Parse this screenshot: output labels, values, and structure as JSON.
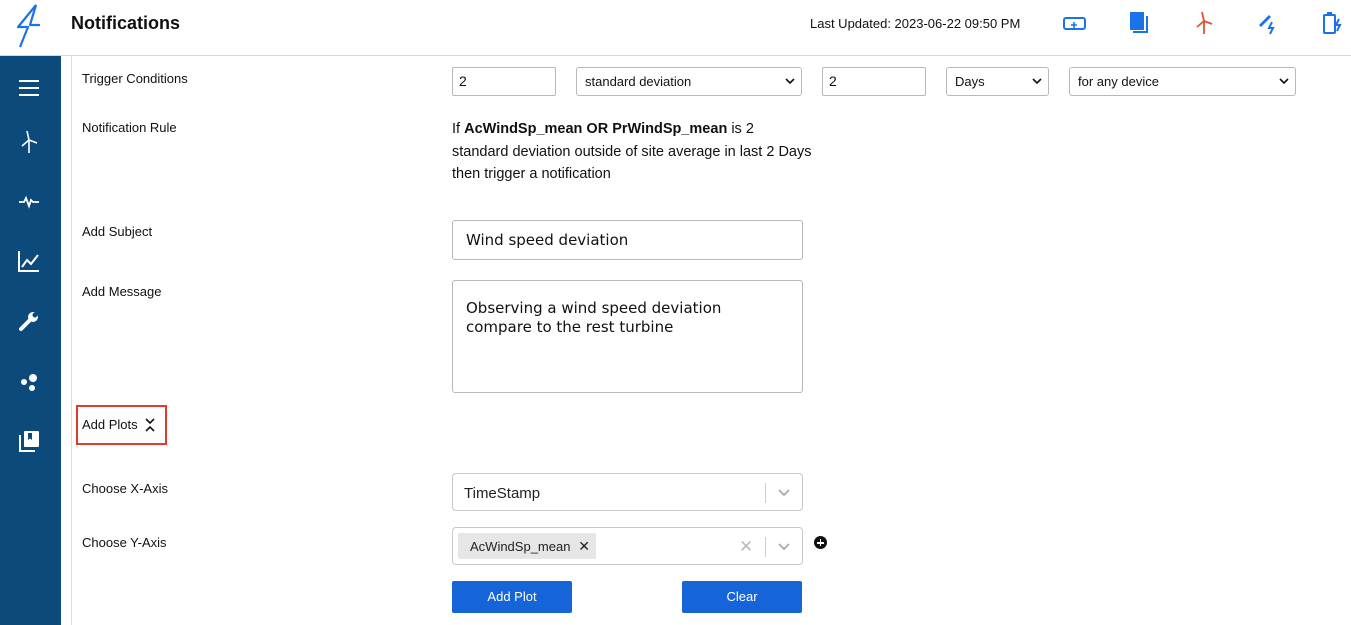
{
  "header": {
    "title": "Notifications",
    "last_updated": "Last Updated: 2023-06-22 09:50 PM"
  },
  "colors": {
    "sidebar": "#0c4a7b",
    "primary_button": "#1565d8",
    "highlight_border": "#e23b2a",
    "icon_blue": "#1a73e8",
    "icon_orange": "#e0542d"
  },
  "header_icons": [
    "controller-icon",
    "documents-icon",
    "wind-turbine-icon",
    "power-edit-icon",
    "battery-charge-icon"
  ],
  "sidebar_icons": [
    "menu-icon",
    "wind-turbine-icon",
    "pulse-icon",
    "line-chart-icon",
    "wrench-icon",
    "cluster-icon",
    "library-icon"
  ],
  "form": {
    "trigger_label": "Trigger Conditions",
    "trigger_value_1": "2",
    "trigger_stat": "standard deviation",
    "trigger_value_2": "2",
    "trigger_unit": "Days",
    "trigger_scope": "for any device",
    "rule_label": "Notification Rule",
    "rule_prefix": "If ",
    "rule_vars": "AcWindSp_mean OR PrWindSp_mean",
    "rule_suffix": " is 2 standard deviation outside of site average in last 2 Days then trigger a notification",
    "subject_label": "Add Subject",
    "subject_value": "Wind speed deviation",
    "message_label": "Add Message",
    "message_value": "Observing a wind speed deviation compare to the rest turbine",
    "plots_label": "Add Plots",
    "x_axis_label": "Choose X-Axis",
    "x_axis_value": "TimeStamp",
    "y_axis_label": "Choose Y-Axis",
    "y_axis_chip": "AcWindSp_mean",
    "add_plot_button": "Add Plot",
    "clear_button": "Clear"
  }
}
